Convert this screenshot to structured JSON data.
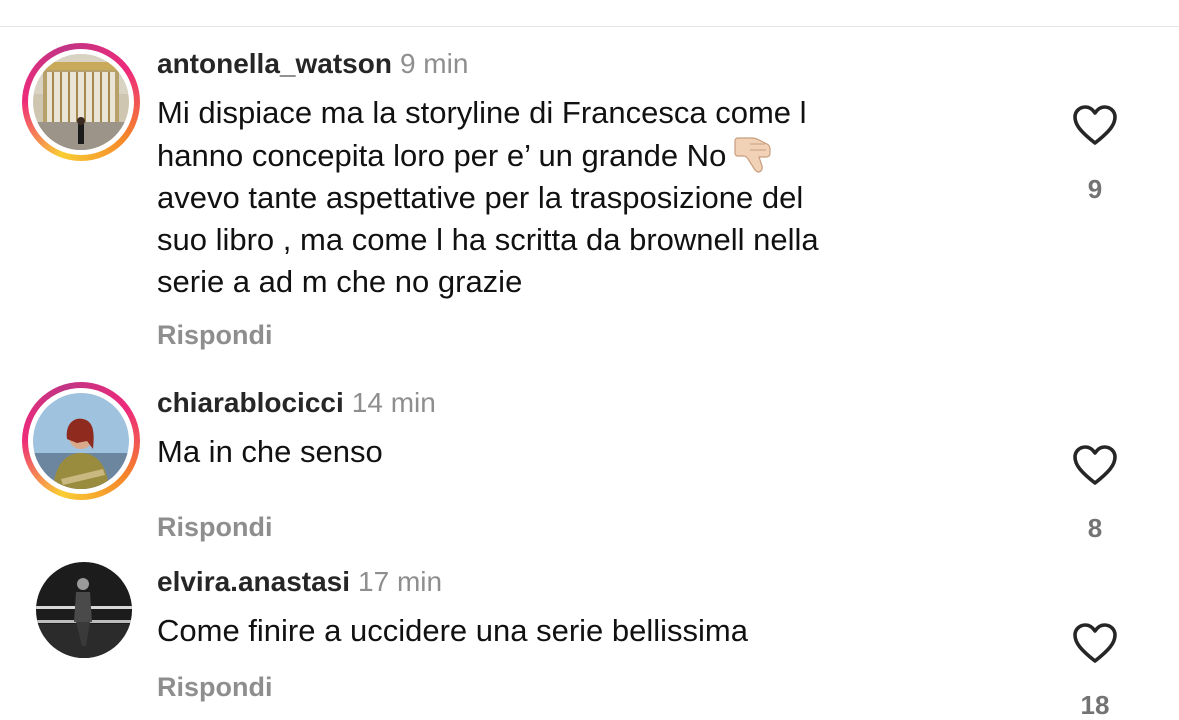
{
  "comments": [
    {
      "username": "antonella_watson",
      "time": "9 min",
      "text_lines": [
        "Mi dispiace ma la storyline di Francesca come l",
        "hanno concepita loro per e’ un grande No",
        "avevo tante aspettative per la trasposizione del",
        "suo libro , ma come l ha scritta da brownell nella",
        "serie a ad m che no grazie"
      ],
      "emoji": "thumbs-down-emoji",
      "reply_label": "Rispondi",
      "likes": "9",
      "avatar_ring": "story-gradient"
    },
    {
      "username": "chiarablocicci",
      "time": "14 min",
      "text": "Ma in che senso",
      "reply_label": "Rispondi",
      "likes": "8",
      "avatar_ring": "story-gradient"
    },
    {
      "username": "elvira.anastasi",
      "time": "17 min",
      "text": "Come finire a uccidere una serie bellissima",
      "reply_label": "Rispondi",
      "likes": "18",
      "avatar_ring": "none"
    }
  ],
  "icons": {
    "like": "heart-outline-icon"
  },
  "colors": {
    "username": "#262626",
    "secondary_text": "#8e8e8e",
    "like_count": "#737373",
    "ring_start": "#f9ce34",
    "ring_mid": "#ee2a7b",
    "ring_end": "#c13584"
  }
}
